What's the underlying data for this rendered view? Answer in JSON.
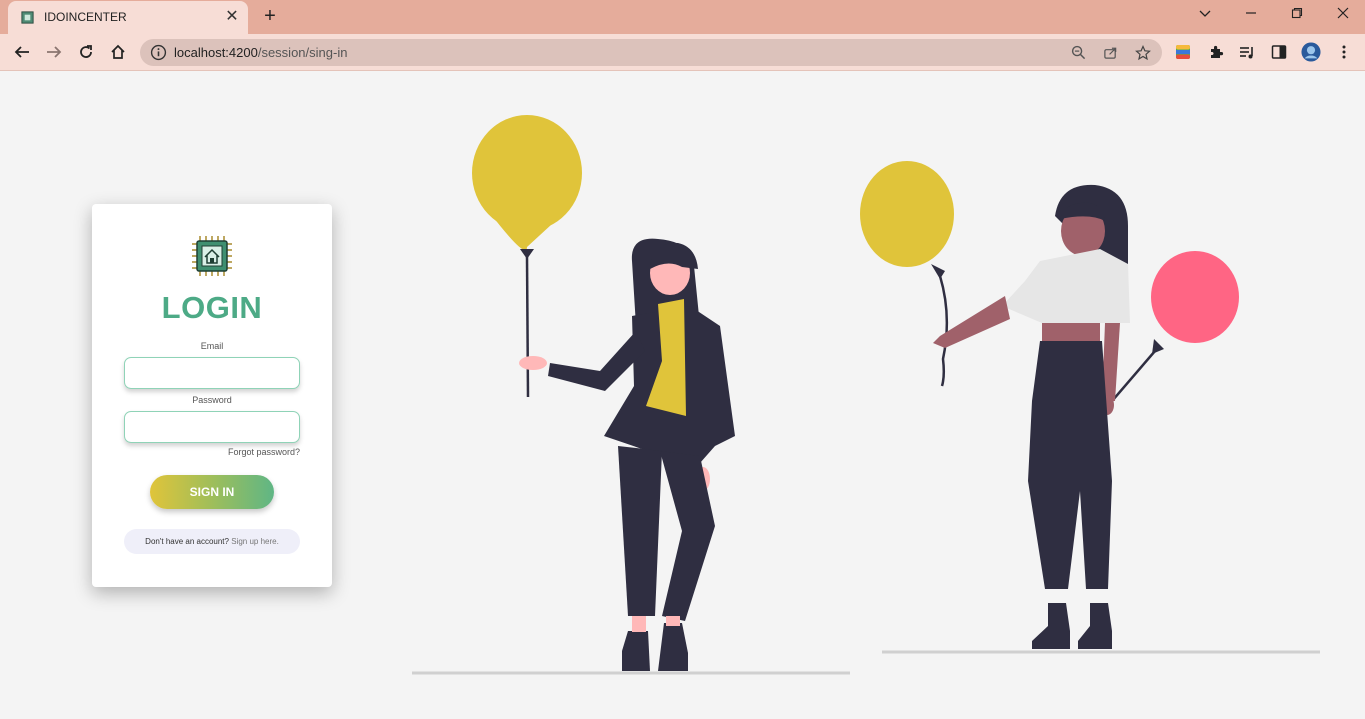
{
  "browser": {
    "tab_title": "IDOINCENTER",
    "url_host": "localhost:4200",
    "url_path": "/session/sing-in"
  },
  "login": {
    "title": "LOGIN",
    "email_label": "Email",
    "email_value": "",
    "password_label": "Password",
    "password_value": "",
    "forgot_label": "Forgot password?",
    "signin_label": "SIGN IN",
    "no_account_text": "Don't have an account?",
    "signup_link": "Sign up here."
  },
  "colors": {
    "chrome_tabstrip": "#e5ac9b",
    "chrome_toolbar": "#f7ddd6",
    "accent_green": "#4daa86",
    "button_gradient_start": "#e0c43a",
    "button_gradient_end": "#5fb685",
    "balloon_yellow": "#e0c43a",
    "balloon_pink": "#ff6584",
    "figure_dark": "#2f2e41"
  }
}
